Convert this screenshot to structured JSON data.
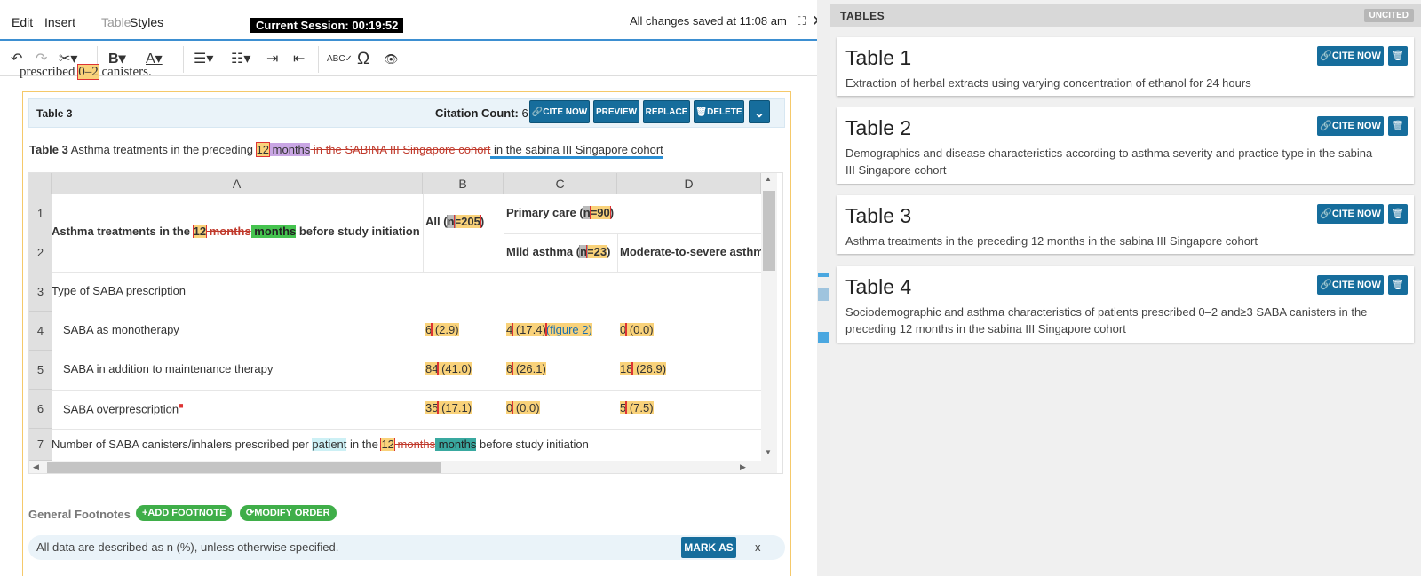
{
  "menu": {
    "edit": "Edit",
    "insert": "Insert",
    "table": "Table",
    "styles": "Styles"
  },
  "session": "Current Session: 00:19:52",
  "save_status": "All changes saved at 11:08 am",
  "toolbar": {
    "undo": "↶",
    "redo": "↷",
    "cut": "✂▾",
    "bold": "B▾",
    "font_color": "A▾",
    "bullets": "☰▾",
    "numbered": "☷▾",
    "indent": "⇥",
    "outdent": "⇤",
    "spell": "ABC✓",
    "omega": "Ω",
    "preview": "👁"
  },
  "overflow_text": {
    "pre": "prescribed",
    "num": "0–2",
    "post": "canisters."
  },
  "block": {
    "name": "Table 3",
    "citation_label": "Citation Count:",
    "citation_count": "6",
    "buttons": {
      "cite": "🔗CITE NOW",
      "preview": "PREVIEW",
      "replace": "REPLACE",
      "delete": "🗑DELETE",
      "collapse": "⌄"
    },
    "caption": {
      "prefix": "Table 3",
      "t1": " Asthma treatments in the preceding ",
      "num": "12",
      "word": " months",
      "deleted": " in the SABINA III Singapore cohort",
      "inserted": " in the sabina III Singapore cohort"
    }
  },
  "grid": {
    "columns": [
      "A",
      "B",
      "C",
      "D"
    ],
    "rows": [
      "1",
      "2",
      "3",
      "4",
      "5",
      "6",
      "7"
    ],
    "header": {
      "a_pre": "Asthma treatments in the ",
      "a_num": "12",
      "a_del": " months",
      "a_ins": " months",
      "a_post": " before study initiation",
      "b_pre": "All (",
      "b_n": "n",
      "b_eq": "=205",
      "b_post": ")",
      "c_pre": "Primary care (",
      "c_n": "n",
      "c_eq": "=90",
      "c_post": ")",
      "c2_pre": "Mild asthma (",
      "c2_n": "n",
      "c2_eq": "=23",
      "c2_post": ")",
      "d2": "Moderate-to-severe asthma"
    },
    "body": {
      "r3": "Type of SABA prescription",
      "r4": {
        "label": "SABA as monotherapy",
        "b1": "6",
        "b2": " (2.9)",
        "c1": "4",
        "c2": " (17.4)",
        "c_link": "(figure 2)",
        "d1": "0",
        "d2": " (0.0)"
      },
      "r5": {
        "label": "SABA in addition to maintenance therapy",
        "b1": "84",
        "b2": " (41.0)",
        "c1": "6",
        "c2": " (26.1)",
        "d1": "18",
        "d2": " (26.9)"
      },
      "r6": {
        "label": "SABA overprescription",
        "b1": "35",
        "b2": " (17.1)",
        "c1": "0",
        "c2": " (0.0)",
        "d1": "5",
        "d2": " (7.5)"
      },
      "r7": {
        "pre": "Number of SABA canisters/inhalers prescribed per ",
        "patient": "patient",
        "in": " in the ",
        "num": "12",
        "del": " months",
        "ins": " months",
        "post": " before study initiation"
      }
    }
  },
  "footnotes": {
    "label": "General Footnotes",
    "add": "+ADD FOOTNOTE",
    "modify": "⟳MODIFY ORDER",
    "text": "All data are described as n (%), unless otherwise specified.",
    "mark_as": "MARK AS",
    "close": "x"
  },
  "panel": {
    "title": "TABLES",
    "badge": "UNCITED",
    "cite_label": "🔗CITE NOW",
    "delete_label": "🗑",
    "cards": [
      {
        "title": "Table 1",
        "desc": "Extraction of herbal extracts using varying concentration of ethanol for 24 hours"
      },
      {
        "title": "Table 2",
        "desc": "Demographics and disease characteristics according to asthma severity and practice type in the sabina III Singapore cohort"
      },
      {
        "title": "Table 3",
        "desc": "Asthma treatments in the preceding 12 months in the sabina III Singapore cohort"
      },
      {
        "title": "Table 4",
        "desc": "Sociodemographic and asthma characteristics of patients prescribed 0–2 and≥3 SABA canisters in the preceding 12 months in the sabina III Singapore cohort"
      }
    ]
  },
  "colors": {
    "accent": "#166d9c",
    "success": "#3fae49",
    "highlight": "#f9d27a",
    "inserted": "#45c34f"
  }
}
